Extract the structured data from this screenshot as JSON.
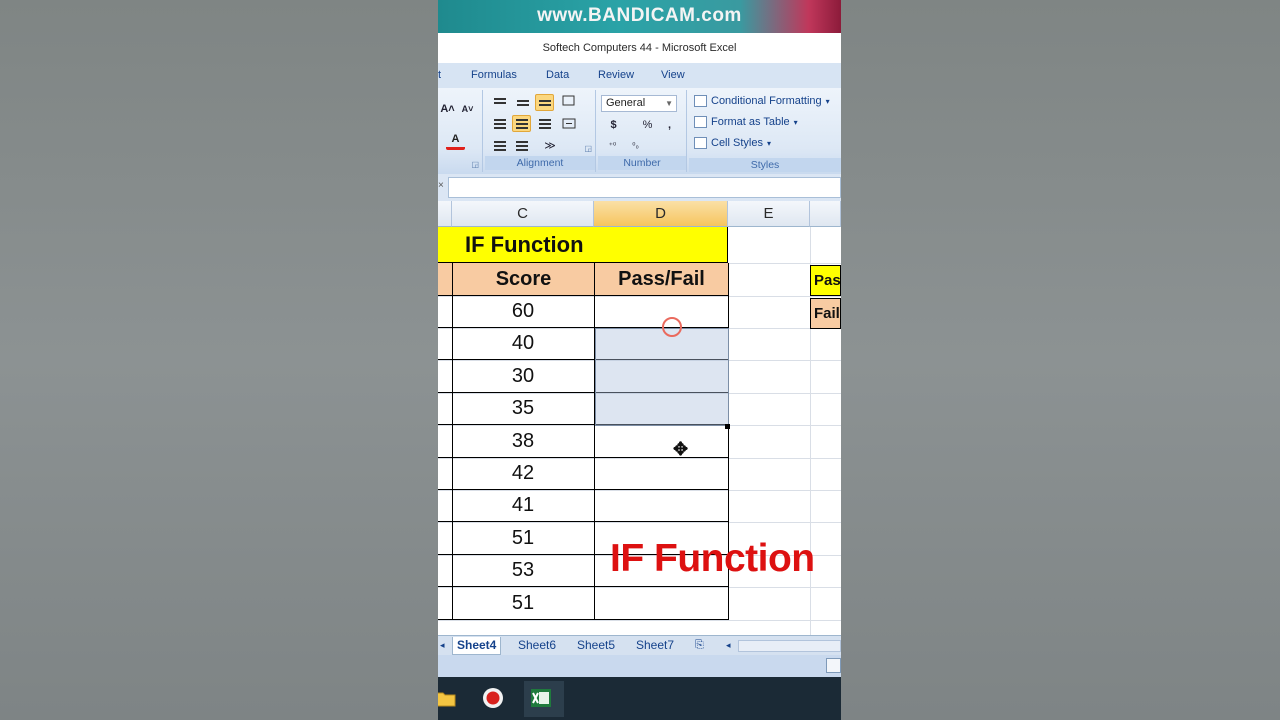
{
  "watermark": "www.BANDICAM.com",
  "window_title": "Softech Computers 44 - Microsoft Excel",
  "ribbon_tabs": [
    "t",
    "Formulas",
    "Data",
    "Review",
    "View"
  ],
  "ribbon": {
    "font_grow": "A˄",
    "font_shrink": "A˅",
    "font_color_letter": "A",
    "alignment_label": "Alignment",
    "number_label": "Number",
    "styles_label": "Styles",
    "number_format": "General",
    "currency": "$",
    "percent": "%",
    "comma": ",",
    "conditional_formatting": "Conditional Formatting",
    "format_as_table": "Format as Table",
    "cell_styles": "Cell Styles"
  },
  "columns": [
    "C",
    "D",
    "E"
  ],
  "sheet": {
    "title": "IF Function",
    "header_score": "Score",
    "header_passfail": "Pass/Fail",
    "scores": [
      "60",
      "40",
      "30",
      "35",
      "38",
      "42",
      "41",
      "51",
      "53",
      "51"
    ],
    "side_keys": [
      "Pass",
      "Fail"
    ]
  },
  "overlay_caption": "IF Function",
  "sheet_tabs": [
    "Sheet4",
    "Sheet6",
    "Sheet5",
    "Sheet7"
  ],
  "active_sheet": "Sheet4",
  "colors": {
    "title_fill": "#ffff00",
    "header_fill": "#f8cba2",
    "caption": "#dd1111",
    "selection": "#afc1dd"
  },
  "icons": [
    "record-icon",
    "excel-icon",
    "folder-icon"
  ]
}
